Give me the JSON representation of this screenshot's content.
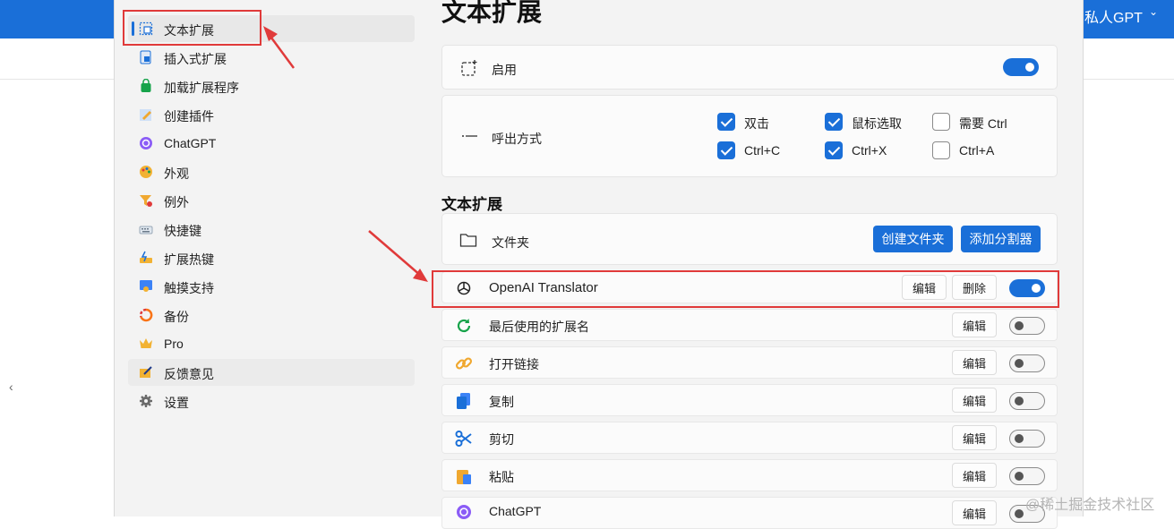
{
  "background": {
    "account_label": "私人GPT",
    "watermark": "@稀土掘金技术社区"
  },
  "sidebar": {
    "items": [
      {
        "label": "文本扩展",
        "icon": "text-expand-icon"
      },
      {
        "label": "插入式扩展",
        "icon": "insert-icon"
      },
      {
        "label": "加载扩展程序",
        "icon": "bag-icon"
      },
      {
        "label": "创建插件",
        "icon": "pencil-icon"
      },
      {
        "label": "ChatGPT",
        "icon": "chatgpt-icon"
      },
      {
        "label": "外观",
        "icon": "palette-icon"
      },
      {
        "label": "例外",
        "icon": "filter-icon"
      },
      {
        "label": "快捷键",
        "icon": "keyboard-icon"
      },
      {
        "label": "扩展热键",
        "icon": "hotkey-icon"
      },
      {
        "label": "触摸支持",
        "icon": "touch-icon"
      },
      {
        "label": "备份",
        "icon": "backup-icon"
      },
      {
        "label": "Pro",
        "icon": "crown-icon"
      },
      {
        "label": "反馈意见",
        "icon": "feedback-icon"
      },
      {
        "label": "设置",
        "icon": "gear-icon"
      }
    ]
  },
  "main": {
    "title": "文本扩展",
    "enable": {
      "label": "启用",
      "on": true
    },
    "invoke": {
      "label": "呼出方式",
      "options": [
        {
          "label": "双击",
          "checked": true
        },
        {
          "label": "鼠标选取",
          "checked": true
        },
        {
          "label": "需要 Ctrl",
          "checked": false
        },
        {
          "label": "Ctrl+C",
          "checked": true
        },
        {
          "label": "Ctrl+X",
          "checked": true
        },
        {
          "label": "Ctrl+A",
          "checked": false
        }
      ]
    },
    "section_title": "文本扩展",
    "folder": {
      "label": "文件夹",
      "create_folder": "创建文件夹",
      "add_separator": "添加分割器"
    },
    "edit_label": "编辑",
    "delete_label": "删除",
    "extensions": [
      {
        "name": "OpenAI Translator",
        "icon": "openai-icon",
        "on": true
      },
      {
        "name": "最后使用的扩展名",
        "icon": "refresh-icon",
        "on": false
      },
      {
        "name": "打开链接",
        "icon": "link-icon",
        "on": false
      },
      {
        "name": "复制",
        "icon": "copy-icon",
        "on": false
      },
      {
        "name": "剪切",
        "icon": "scissors-icon",
        "on": false
      },
      {
        "name": "粘贴",
        "icon": "paste-icon",
        "on": false
      },
      {
        "name": "ChatGPT",
        "icon": "chatgpt-icon",
        "on": false
      }
    ]
  },
  "colors": {
    "accent": "#1a6fd8",
    "annotation_red": "#e03a3a"
  }
}
